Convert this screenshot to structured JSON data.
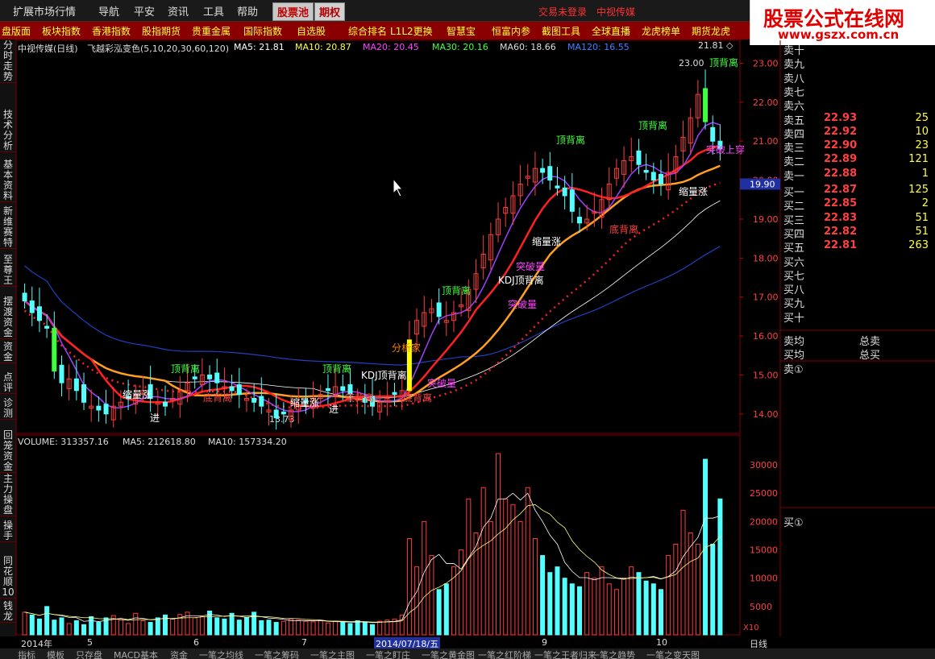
{
  "menu": {
    "items": [
      "扩展市场行情",
      "导航",
      "平安",
      "资讯",
      "工具",
      "帮助"
    ],
    "tab_stockpool": "股票池",
    "tab_options": "期权",
    "status_login": "交易未登录",
    "stock_name": "中视传媒"
  },
  "logo": {
    "title": "股票公式在线网",
    "url": "www.gszx.com.cn"
  },
  "toolbar": {
    "items": [
      "盘版面",
      "板块指数",
      "香港指数",
      "股指期货",
      "贵重金属",
      "国际指数",
      "自选股",
      "综合排名",
      "L1L2更换",
      "智慧宝",
      "恒富内参",
      "截图工具",
      "全球直播",
      "龙虎榜单",
      "期货龙虎"
    ]
  },
  "left_tabs": [
    "分时走势",
    "技术分析",
    "基本资料",
    "新维赛特",
    "至尊王",
    "摆渡资金",
    "资金",
    "点评",
    "诊测",
    "回笼资金",
    "主力操盘",
    "操手",
    "同花顺10",
    "钱龙"
  ],
  "kline_header": {
    "title": "中视传媒(日线)",
    "indicator": "飞越彩泓变色(5,10,20,30,60,120)",
    "ma5": "MA5: 21.81",
    "ma10": "MA10: 20.87",
    "ma20": "MA20: 20.45",
    "ma30": "MA30: 20.16",
    "ma60": "MA60: 18.66",
    "ma120": "MA120: 16.55"
  },
  "vol_header": {
    "volume": "VOLUME: 313357.16",
    "ma5": "MA5: 212618.80",
    "ma10": "MA10: 157334.20"
  },
  "price_axis": {
    "labels": [
      "23.00",
      "22.00",
      "21.00",
      "20.00",
      "19.00",
      "18.00",
      "17.00",
      "16.00",
      "15.00",
      "14.00"
    ],
    "current": "19.90",
    "top_label": "21.81 ◇",
    "high_label": "23.00",
    "low_label": "13.73"
  },
  "vol_axis": {
    "labels": [
      "30000",
      "25000",
      "20000",
      "15000",
      "10000",
      "5000"
    ],
    "unit": "X10"
  },
  "annotations": {
    "top_div": "顶背离",
    "bottom_div": "底背离",
    "kdj_top_div": "KDJ顶背离",
    "shrink_rise": "缩量涨",
    "breakout": "突破量",
    "enter": "进",
    "above_line": "突破上穿",
    "fund_watch": "分析家"
  },
  "order_book": {
    "sell": [
      {
        "label": "卖十",
        "price": "",
        "vol": ""
      },
      {
        "label": "卖九",
        "price": "",
        "vol": ""
      },
      {
        "label": "卖八",
        "price": "",
        "vol": ""
      },
      {
        "label": "卖七",
        "price": "",
        "vol": ""
      },
      {
        "label": "卖六",
        "price": "",
        "vol": ""
      },
      {
        "label": "卖五",
        "price": "22.93",
        "vol": "25"
      },
      {
        "label": "卖四",
        "price": "22.92",
        "vol": "10"
      },
      {
        "label": "卖三",
        "price": "22.90",
        "vol": "23"
      },
      {
        "label": "卖二",
        "price": "22.89",
        "vol": "121"
      },
      {
        "label": "卖一",
        "price": "22.88",
        "vol": "1"
      }
    ],
    "buy": [
      {
        "label": "买一",
        "price": "22.87",
        "vol": "125"
      },
      {
        "label": "买二",
        "price": "22.85",
        "vol": "2"
      },
      {
        "label": "买三",
        "price": "22.83",
        "vol": "51"
      },
      {
        "label": "买四",
        "price": "22.82",
        "vol": "51"
      },
      {
        "label": "买五",
        "price": "22.81",
        "vol": "263"
      },
      {
        "label": "买六",
        "price": "",
        "vol": ""
      },
      {
        "label": "买七",
        "price": "",
        "vol": ""
      },
      {
        "label": "买八",
        "price": "",
        "vol": ""
      },
      {
        "label": "买九",
        "price": "",
        "vol": ""
      },
      {
        "label": "买十",
        "price": "",
        "vol": ""
      }
    ],
    "sell_avg": "卖均",
    "total_sell": "总卖",
    "buy_avg": "买均",
    "total_buy": "总买",
    "sell_1_queue": "卖①",
    "buy_1_queue": "买①"
  },
  "date_axis": {
    "labels": [
      "2014年",
      "5",
      "6",
      "7",
      "2014/07/18/五",
      "9",
      "10"
    ],
    "period": "日线"
  },
  "bottom_tabs": [
    "指标",
    "模板",
    "只存盘",
    "MACD基本",
    "资金",
    "一笔之均线",
    "一笔之筹码",
    "一笔之主图",
    "一笔之盯庄",
    "一笔之黄金图",
    "一笔之红阶梯",
    "一笔之王者归来",
    "一笔之趋势",
    "一笔之变天图"
  ],
  "chart_data": [
    {
      "type": "candlestick",
      "title": "中视传媒(日线)",
      "ylim": [
        13.5,
        23.3
      ],
      "x_categories": [
        "2014年",
        "5",
        "6",
        "7",
        "2014/07/18/五",
        "9",
        "10"
      ],
      "note_high": 23.0,
      "note_low": 13.73,
      "close": [
        16.9,
        16.6,
        16.4,
        16.2,
        15.1,
        14.8,
        14.9,
        14.6,
        14.3,
        14.2,
        14.1,
        14.0,
        14.2,
        14.3,
        14.4,
        14.5,
        14.6,
        14.4,
        14.3,
        14.2,
        14.4,
        14.6,
        14.8,
        14.9,
        15.0,
        14.9,
        14.8,
        14.7,
        14.6,
        14.5,
        14.4,
        14.3,
        14.2,
        14.1,
        13.9,
        14.0,
        14.1,
        14.2,
        14.3,
        14.4,
        14.5,
        14.6,
        14.7,
        14.6,
        14.5,
        14.4,
        14.3,
        14.2,
        14.3,
        14.4,
        14.5,
        14.6,
        15.9,
        16.4,
        16.6,
        16.7,
        16.5,
        16.4,
        16.6,
        16.8,
        17.2,
        17.6,
        18.1,
        18.6,
        19.0,
        19.3,
        19.6,
        19.9,
        20.1,
        20.3,
        20.2,
        20.0,
        19.8,
        19.6,
        19.2,
        18.9,
        19.0,
        19.2,
        19.5,
        19.9,
        20.3,
        20.5,
        20.6,
        20.4,
        20.2,
        20.0,
        19.9,
        20.2,
        20.6,
        21.1,
        21.6,
        22.2,
        21.5,
        21.0,
        20.8
      ]
    },
    {
      "type": "bar",
      "title": "VOLUME",
      "ylim": [
        0,
        33000
      ],
      "volume": [
        4000,
        3500,
        2800,
        5000,
        2600,
        3000,
        2000,
        2500,
        1800,
        3200,
        2200,
        3000,
        3400,
        2800,
        2000,
        3800,
        2500,
        2200,
        3000,
        3500,
        2800,
        3600,
        4000,
        3000,
        3200,
        4200,
        3000,
        2800,
        3800,
        2600,
        3100,
        4000,
        2500,
        2600,
        2200,
        2400,
        2800,
        2600,
        2400,
        2300,
        2500,
        2100,
        2400,
        2200,
        2000,
        2500,
        2300,
        1800,
        2400,
        2600,
        2800,
        3500,
        17000,
        12000,
        20000,
        14000,
        8000,
        9000,
        12000,
        15000,
        24000,
        18000,
        26000,
        20000,
        32000,
        24000,
        23000,
        20000,
        26000,
        17000,
        14000,
        11000,
        12000,
        10000,
        9000,
        8500,
        11000,
        10000,
        12000,
        9000,
        8000,
        10000,
        12000,
        11000,
        9500,
        9000,
        8000,
        14000,
        16000,
        22000,
        18000,
        16000,
        31000,
        16000,
        24000
      ]
    }
  ],
  "colors": {
    "up": "#ff3c3c",
    "down": "#54ffff",
    "bg": "#000000",
    "grid": "#800000",
    "yellow": "#ffff00"
  }
}
